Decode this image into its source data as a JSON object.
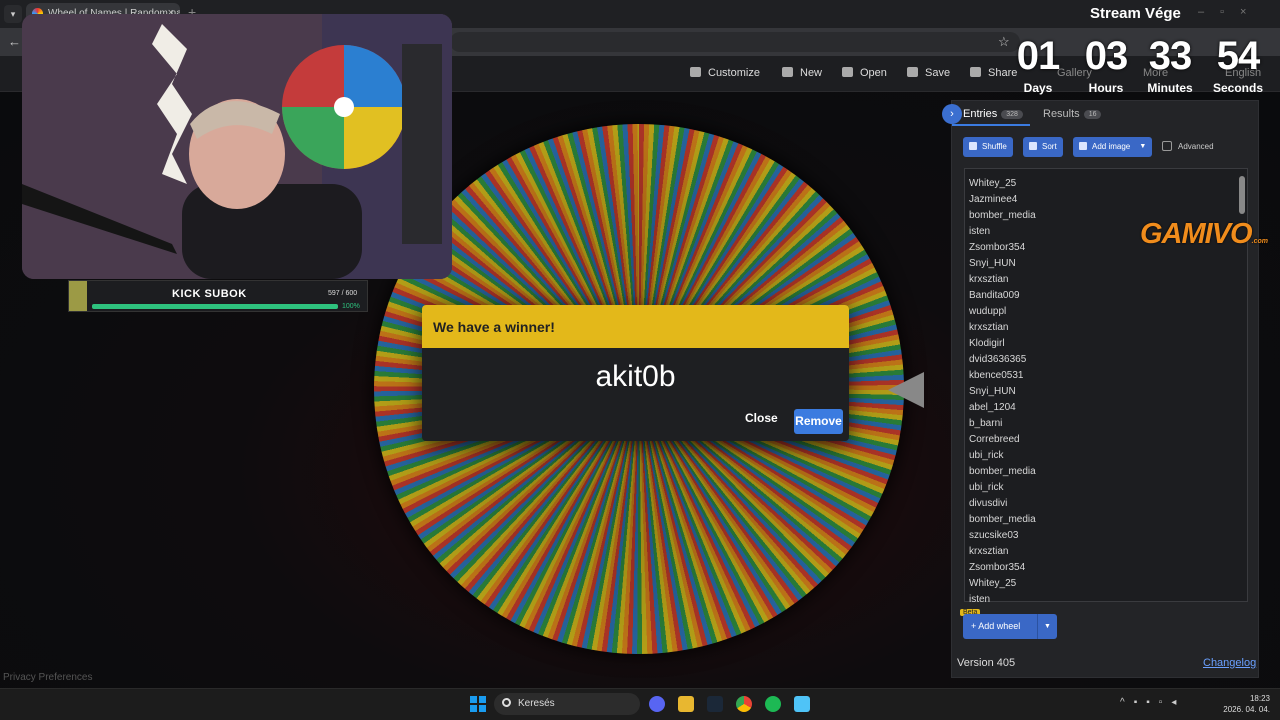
{
  "browser": {
    "tab_title": "Wheel of Names | Random name picker",
    "tab_title_visible": "Wheel of Names | Random nam",
    "new_tab": "+",
    "back": "←",
    "star": "☆"
  },
  "stream": {
    "title": "Stream Vége",
    "countdown": [
      {
        "value": "01",
        "label": "Days"
      },
      {
        "value": "03",
        "label": "Hours"
      },
      {
        "value": "33",
        "label": "Minutes"
      },
      {
        "value": "54",
        "label": "Seconds"
      }
    ],
    "sub_goal": {
      "title": "KICK SUBOK",
      "count": "597 / 600",
      "percent": "100%"
    },
    "sponsor": "GAMIVO",
    "sponsor_suffix": ".com"
  },
  "toolbar": {
    "customize": "Customize",
    "new": "New",
    "open": "Open",
    "save": "Save",
    "share": "Share",
    "gallery": "Gallery",
    "more": "More",
    "language": "English"
  },
  "dialog": {
    "heading": "We have a winner!",
    "winner": "akit0b",
    "close": "Close",
    "remove": "Remove"
  },
  "panel": {
    "tab_entries": "Entries",
    "entries_count": "328",
    "tab_results": "Results",
    "results_count": "16",
    "shuffle": "Shuffle",
    "sort": "Sort",
    "add_image": "Add image",
    "advanced": "Advanced",
    "entries": [
      "Whitey_25",
      "Jazminee4",
      "bomber_media",
      "isten",
      "Zsombor354",
      "Snyi_HUN",
      "krxsztian",
      "Bandita009",
      "wuduppl",
      "krxsztian",
      "Klodigirl",
      "dvid3636365",
      "kbence0531",
      "Snyi_HUN",
      "abel_1204",
      "b_barni",
      "Correbreed",
      "ubi_rick",
      "bomber_media",
      "ubi_rick",
      "divusdivi",
      "bomber_media",
      "szucsike03",
      "krxsztian",
      "Zsombor354",
      "Whitey_25",
      "isten"
    ],
    "beta": "Beta",
    "add_wheel": "Add wheel",
    "version": "Version 405",
    "changelog": "Changelog"
  },
  "footer": {
    "privacy": "Privacy Preferences"
  },
  "taskbar": {
    "search": "Keresés",
    "time": "18:23",
    "date": "2026. 04. 04."
  },
  "colors": {
    "accent": "#3b7be0",
    "dialog_header": "#e3b81a",
    "progress": "#2ec27e",
    "sponsor": "#f08c1c"
  }
}
